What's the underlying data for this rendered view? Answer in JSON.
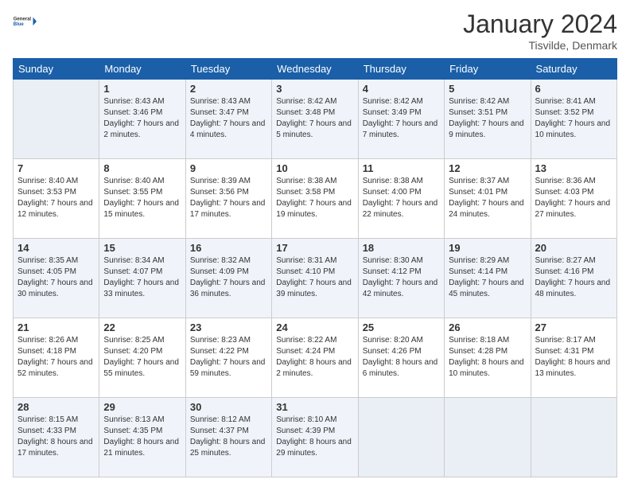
{
  "logo": {
    "line1": "General",
    "line2": "Blue"
  },
  "title": "January 2024",
  "location": "Tisvilde, Denmark",
  "days_header": [
    "Sunday",
    "Monday",
    "Tuesday",
    "Wednesday",
    "Thursday",
    "Friday",
    "Saturday"
  ],
  "weeks": [
    [
      {
        "num": "",
        "empty": true
      },
      {
        "num": "1",
        "sunrise": "8:43 AM",
        "sunset": "3:46 PM",
        "daylight": "7 hours and 2 minutes."
      },
      {
        "num": "2",
        "sunrise": "8:43 AM",
        "sunset": "3:47 PM",
        "daylight": "7 hours and 4 minutes."
      },
      {
        "num": "3",
        "sunrise": "8:42 AM",
        "sunset": "3:48 PM",
        "daylight": "7 hours and 5 minutes."
      },
      {
        "num": "4",
        "sunrise": "8:42 AM",
        "sunset": "3:49 PM",
        "daylight": "7 hours and 7 minutes."
      },
      {
        "num": "5",
        "sunrise": "8:42 AM",
        "sunset": "3:51 PM",
        "daylight": "7 hours and 9 minutes."
      },
      {
        "num": "6",
        "sunrise": "8:41 AM",
        "sunset": "3:52 PM",
        "daylight": "7 hours and 10 minutes."
      }
    ],
    [
      {
        "num": "7",
        "sunrise": "8:40 AM",
        "sunset": "3:53 PM",
        "daylight": "7 hours and 12 minutes."
      },
      {
        "num": "8",
        "sunrise": "8:40 AM",
        "sunset": "3:55 PM",
        "daylight": "7 hours and 15 minutes."
      },
      {
        "num": "9",
        "sunrise": "8:39 AM",
        "sunset": "3:56 PM",
        "daylight": "7 hours and 17 minutes."
      },
      {
        "num": "10",
        "sunrise": "8:38 AM",
        "sunset": "3:58 PM",
        "daylight": "7 hours and 19 minutes."
      },
      {
        "num": "11",
        "sunrise": "8:38 AM",
        "sunset": "4:00 PM",
        "daylight": "7 hours and 22 minutes."
      },
      {
        "num": "12",
        "sunrise": "8:37 AM",
        "sunset": "4:01 PM",
        "daylight": "7 hours and 24 minutes."
      },
      {
        "num": "13",
        "sunrise": "8:36 AM",
        "sunset": "4:03 PM",
        "daylight": "7 hours and 27 minutes."
      }
    ],
    [
      {
        "num": "14",
        "sunrise": "8:35 AM",
        "sunset": "4:05 PM",
        "daylight": "7 hours and 30 minutes."
      },
      {
        "num": "15",
        "sunrise": "8:34 AM",
        "sunset": "4:07 PM",
        "daylight": "7 hours and 33 minutes."
      },
      {
        "num": "16",
        "sunrise": "8:32 AM",
        "sunset": "4:09 PM",
        "daylight": "7 hours and 36 minutes."
      },
      {
        "num": "17",
        "sunrise": "8:31 AM",
        "sunset": "4:10 PM",
        "daylight": "7 hours and 39 minutes."
      },
      {
        "num": "18",
        "sunrise": "8:30 AM",
        "sunset": "4:12 PM",
        "daylight": "7 hours and 42 minutes."
      },
      {
        "num": "19",
        "sunrise": "8:29 AM",
        "sunset": "4:14 PM",
        "daylight": "7 hours and 45 minutes."
      },
      {
        "num": "20",
        "sunrise": "8:27 AM",
        "sunset": "4:16 PM",
        "daylight": "7 hours and 48 minutes."
      }
    ],
    [
      {
        "num": "21",
        "sunrise": "8:26 AM",
        "sunset": "4:18 PM",
        "daylight": "7 hours and 52 minutes."
      },
      {
        "num": "22",
        "sunrise": "8:25 AM",
        "sunset": "4:20 PM",
        "daylight": "7 hours and 55 minutes."
      },
      {
        "num": "23",
        "sunrise": "8:23 AM",
        "sunset": "4:22 PM",
        "daylight": "7 hours and 59 minutes."
      },
      {
        "num": "24",
        "sunrise": "8:22 AM",
        "sunset": "4:24 PM",
        "daylight": "8 hours and 2 minutes."
      },
      {
        "num": "25",
        "sunrise": "8:20 AM",
        "sunset": "4:26 PM",
        "daylight": "8 hours and 6 minutes."
      },
      {
        "num": "26",
        "sunrise": "8:18 AM",
        "sunset": "4:28 PM",
        "daylight": "8 hours and 10 minutes."
      },
      {
        "num": "27",
        "sunrise": "8:17 AM",
        "sunset": "4:31 PM",
        "daylight": "8 hours and 13 minutes."
      }
    ],
    [
      {
        "num": "28",
        "sunrise": "8:15 AM",
        "sunset": "4:33 PM",
        "daylight": "8 hours and 17 minutes."
      },
      {
        "num": "29",
        "sunrise": "8:13 AM",
        "sunset": "4:35 PM",
        "daylight": "8 hours and 21 minutes."
      },
      {
        "num": "30",
        "sunrise": "8:12 AM",
        "sunset": "4:37 PM",
        "daylight": "8 hours and 25 minutes."
      },
      {
        "num": "31",
        "sunrise": "8:10 AM",
        "sunset": "4:39 PM",
        "daylight": "8 hours and 29 minutes."
      },
      {
        "num": "",
        "empty": true
      },
      {
        "num": "",
        "empty": true
      },
      {
        "num": "",
        "empty": true
      }
    ]
  ]
}
